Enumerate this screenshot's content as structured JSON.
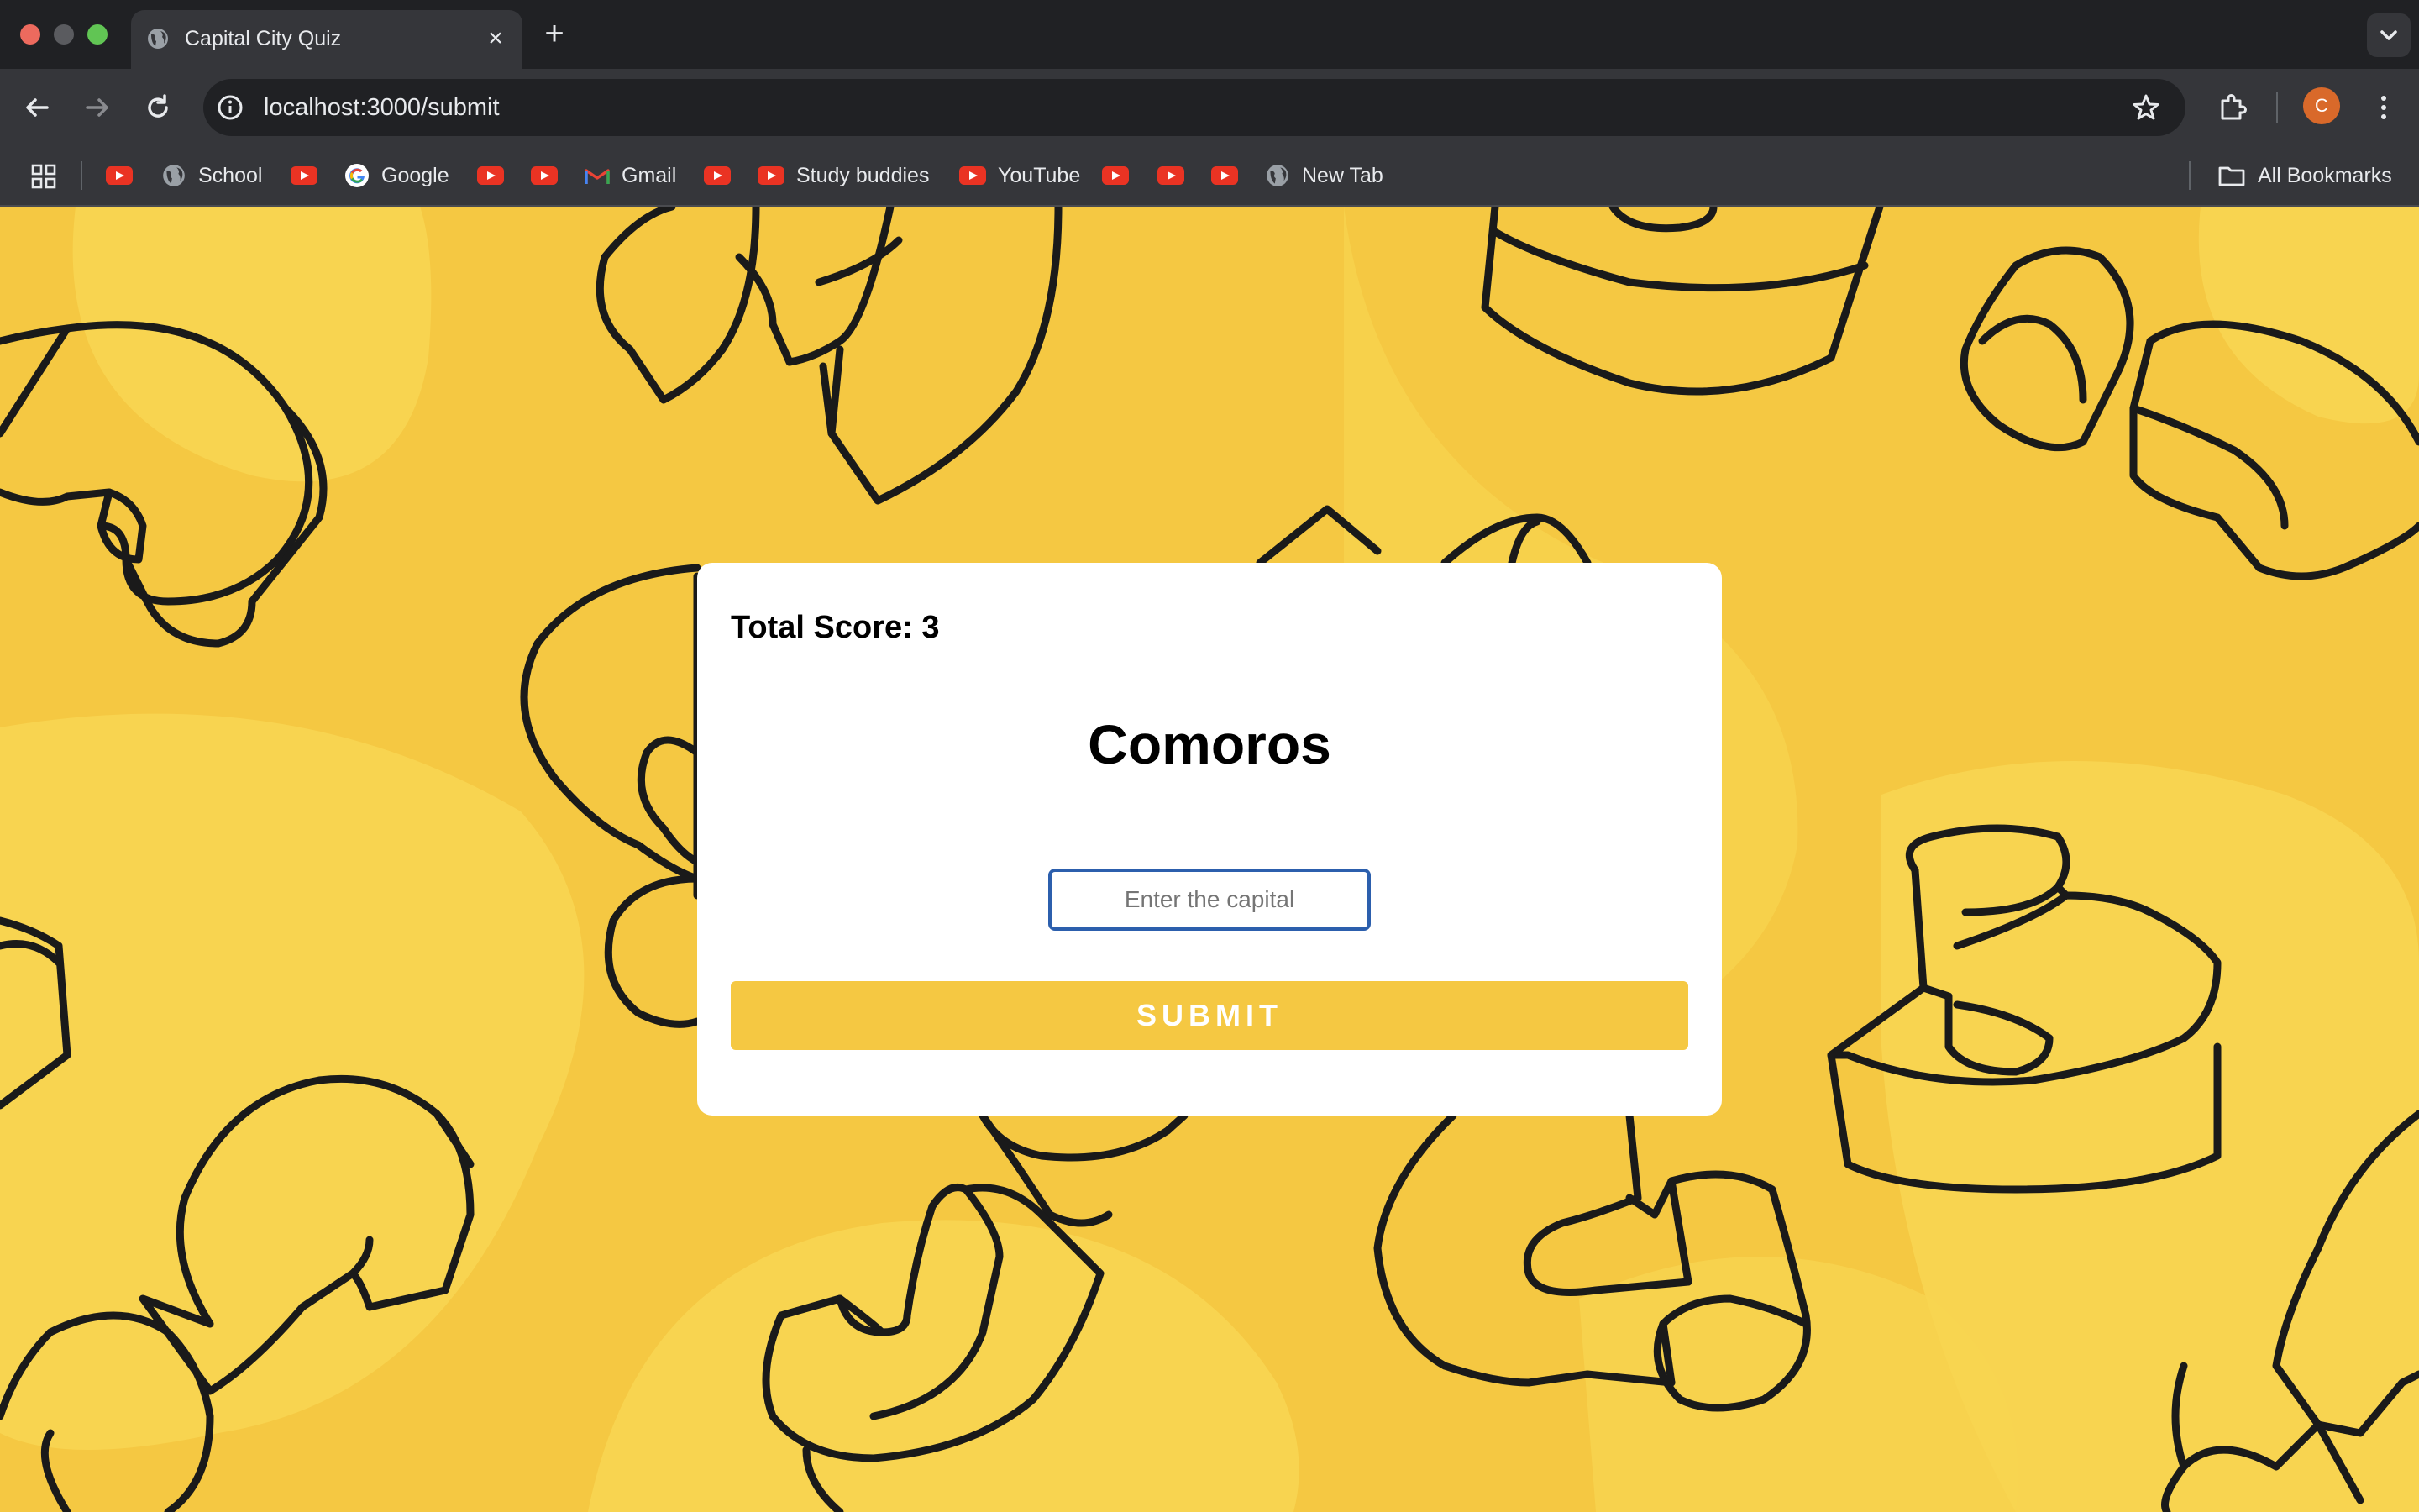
{
  "browser": {
    "tab_title": "Capital City Quiz",
    "tab_close": "×",
    "new_tab": "+",
    "url": "localhost:3000/submit",
    "profile_initial": "C"
  },
  "bookmarks": {
    "items": [
      {
        "type": "youtube"
      },
      {
        "type": "globe",
        "label": "School"
      },
      {
        "type": "youtube"
      },
      {
        "type": "google",
        "label": "Google"
      },
      {
        "type": "youtube"
      },
      {
        "type": "youtube"
      },
      {
        "type": "gmail",
        "label": "Gmail"
      },
      {
        "type": "youtube"
      },
      {
        "type": "youtube",
        "label": "Study buddies"
      },
      {
        "type": "youtube",
        "label": "YouTube"
      },
      {
        "type": "youtube"
      },
      {
        "type": "youtube"
      },
      {
        "type": "youtube"
      },
      {
        "type": "globe",
        "label": "New Tab"
      }
    ],
    "all_bookmarks": "All Bookmarks"
  },
  "quiz": {
    "score_label": "Total Score: 3",
    "country": "Comoros",
    "answer_placeholder": "Enter the capital",
    "submit_label": "SUBMIT"
  },
  "colors": {
    "background": "#f5c842",
    "card": "#ffffff",
    "submit_button": "#f5c842",
    "input_border": "#2c5fad"
  }
}
